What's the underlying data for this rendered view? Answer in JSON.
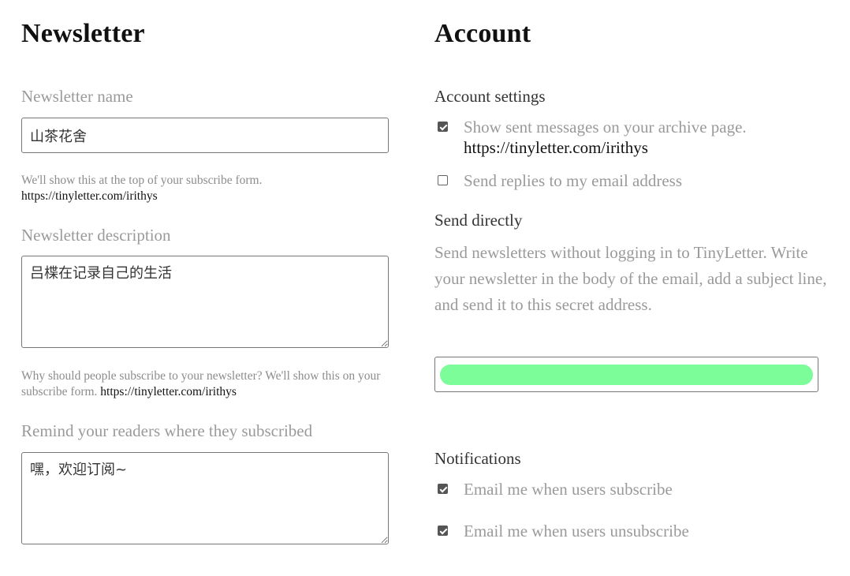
{
  "newsletter": {
    "heading": "Newsletter",
    "name_label": "Newsletter name",
    "name_value": "山茶花舍",
    "name_help": "We'll show this at the top of your subscribe form.",
    "name_help_link": "https://tinyletter.com/irithys",
    "description_label": "Newsletter description",
    "description_value": "吕楪在记录自己的生活",
    "description_help": "Why should people subscribe to your newsletter? We'll show this on your subscribe form.",
    "description_help_link": "https://tinyletter.com/irithys",
    "reminder_label": "Remind your readers where they subscribed",
    "reminder_value": "嘿，欢迎订阅~"
  },
  "account": {
    "heading": "Account",
    "settings_title": "Account settings",
    "show_archive": {
      "label": "Show sent messages on your archive page.",
      "link": "https://tinyletter.com/irithys",
      "checked": true
    },
    "send_replies": {
      "label": "Send replies to my email address",
      "checked": false
    },
    "send_directly_title": "Send directly",
    "send_directly_text": "Send newsletters without logging in to TinyLetter. Write your newsletter in the body of the email, add a subject line, and send it to this secret address.",
    "secret_redaction_color": "#7dfc9a",
    "notifications_title": "Notifications",
    "notify_subscribe": {
      "label": "Email me when users subscribe",
      "checked": true
    },
    "notify_unsubscribe": {
      "label": "Email me when users unsubscribe",
      "checked": true
    }
  }
}
